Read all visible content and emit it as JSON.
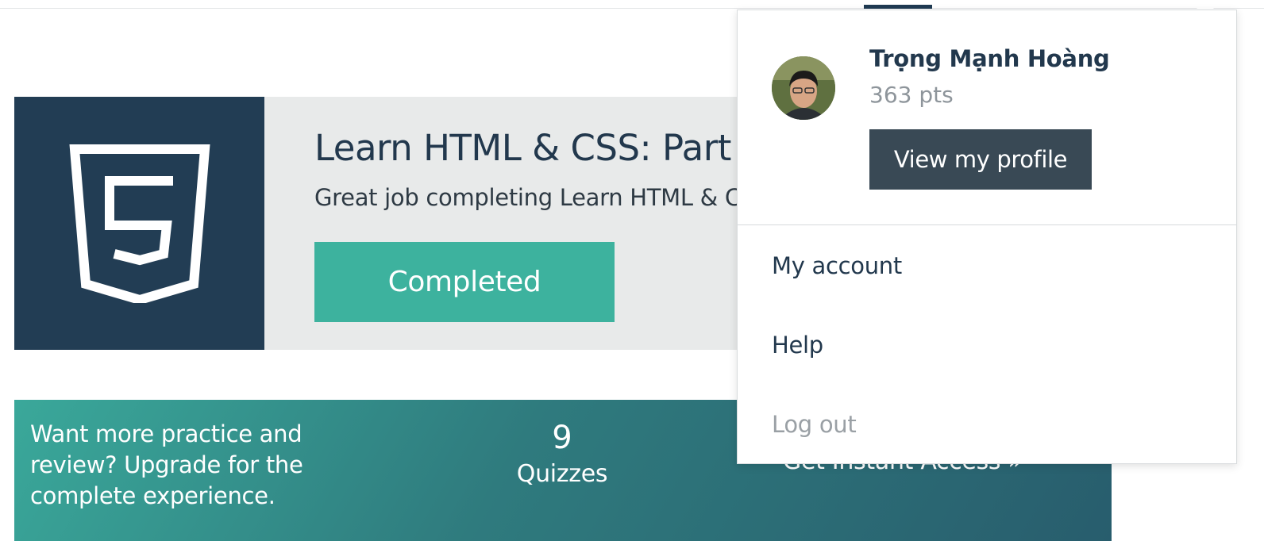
{
  "course": {
    "title": "Learn HTML & CSS: Part I",
    "message": "Great job completing Learn HTML & CSS: Part I!",
    "status_label": "Completed",
    "badge_icon": "html5-shield-icon"
  },
  "upgrade": {
    "text": "Want more practice and review? Upgrade for the complete experience.",
    "quiz_count": "9",
    "quiz_label": "Quizzes",
    "cta_label": "Get Instant Access »"
  },
  "user_menu": {
    "name": "Trọng Mạnh Hoàng",
    "points": "363 pts",
    "view_profile_label": "View my profile",
    "items": [
      {
        "label": "My account"
      },
      {
        "label": "Help"
      },
      {
        "label": "Log out"
      }
    ]
  },
  "colors": {
    "navy": "#223d54",
    "teal": "#3db29e",
    "dark_button": "#394955",
    "card_bg": "#e8eaea"
  }
}
